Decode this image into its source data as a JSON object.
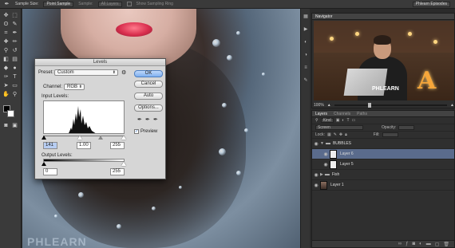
{
  "options_bar": {
    "sample_size_label": "Sample Size:",
    "sample_size_value": "Point Sample",
    "sample_label": "Sample:",
    "sample_value": "All Layers",
    "show_ring_label": "Show Sampling Ring",
    "workspace": "Phlearn Episodes"
  },
  "canvas": {
    "watermark": "PHLEARN"
  },
  "navigator": {
    "title": "Navigator",
    "zoom": "100%",
    "shirt_text": "PHLEARN",
    "sign_letter": "A"
  },
  "layers_panel": {
    "tabs": [
      "Layers",
      "Channels",
      "Paths"
    ],
    "kind_label": "Kind",
    "blend_mode": "Screen",
    "opacity_label": "Opacity:",
    "lock_label": "Lock:",
    "fill_label": "Fill:",
    "layers": [
      {
        "name": "BUBBLES",
        "type": "group",
        "selected": false
      },
      {
        "name": "Layer 6",
        "type": "layer",
        "selected": true
      },
      {
        "name": "Layer 5",
        "type": "layer",
        "selected": false
      },
      {
        "name": "Fish",
        "type": "group",
        "selected": false
      },
      {
        "name": "Layer 1",
        "type": "photo",
        "selected": false
      }
    ]
  },
  "levels_dialog": {
    "title": "Levels",
    "preset_label": "Preset:",
    "preset_value": "Custom",
    "channel_label": "Channel:",
    "channel_value": "RGB",
    "input_label": "Input Levels:",
    "input_black": "141",
    "input_gamma": "1.00",
    "input_white": "255",
    "output_label": "Output Levels:",
    "output_black": "0",
    "output_white": "255",
    "ok": "OK",
    "cancel": "Cancel",
    "auto": "Auto",
    "options": "Options...",
    "preview": "Preview",
    "preview_checked": true
  },
  "colors": {
    "selected_layer": "#5a6b8c",
    "ok_button": "#7fb0ef"
  }
}
